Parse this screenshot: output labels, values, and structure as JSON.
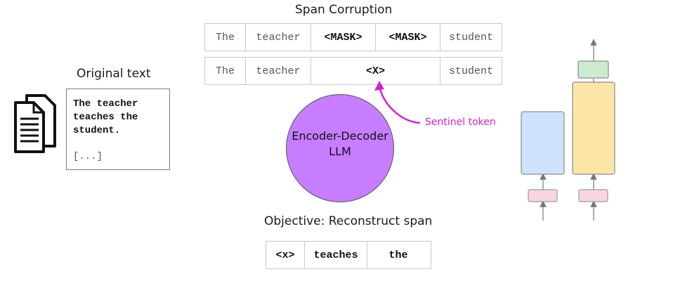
{
  "title": "Span Corruption",
  "corrupted_row": [
    "The",
    "teacher",
    "<MASK>",
    "<MASK>",
    "student"
  ],
  "sentinel_row": [
    "The",
    "teacher",
    "<X>",
    "student"
  ],
  "original": {
    "heading": "Original text",
    "text": "The teacher\nteaches the\nstudent.",
    "more": "[...]"
  },
  "model": {
    "label": "Encoder-Decoder\nLLM",
    "color": "#c77dff"
  },
  "sentinel_label": "Sentinel token",
  "objective": {
    "heading": "Objective: Reconstruct span",
    "tokens": [
      "<x>",
      "teaches",
      "the"
    ]
  },
  "colors": {
    "sentinel": "#d61ed6",
    "encoder_block": "#cfe2fb",
    "decoder_block": "#fbe6a7",
    "output_block": "#cdebcf",
    "embedding_block": "#f7d6e0"
  }
}
